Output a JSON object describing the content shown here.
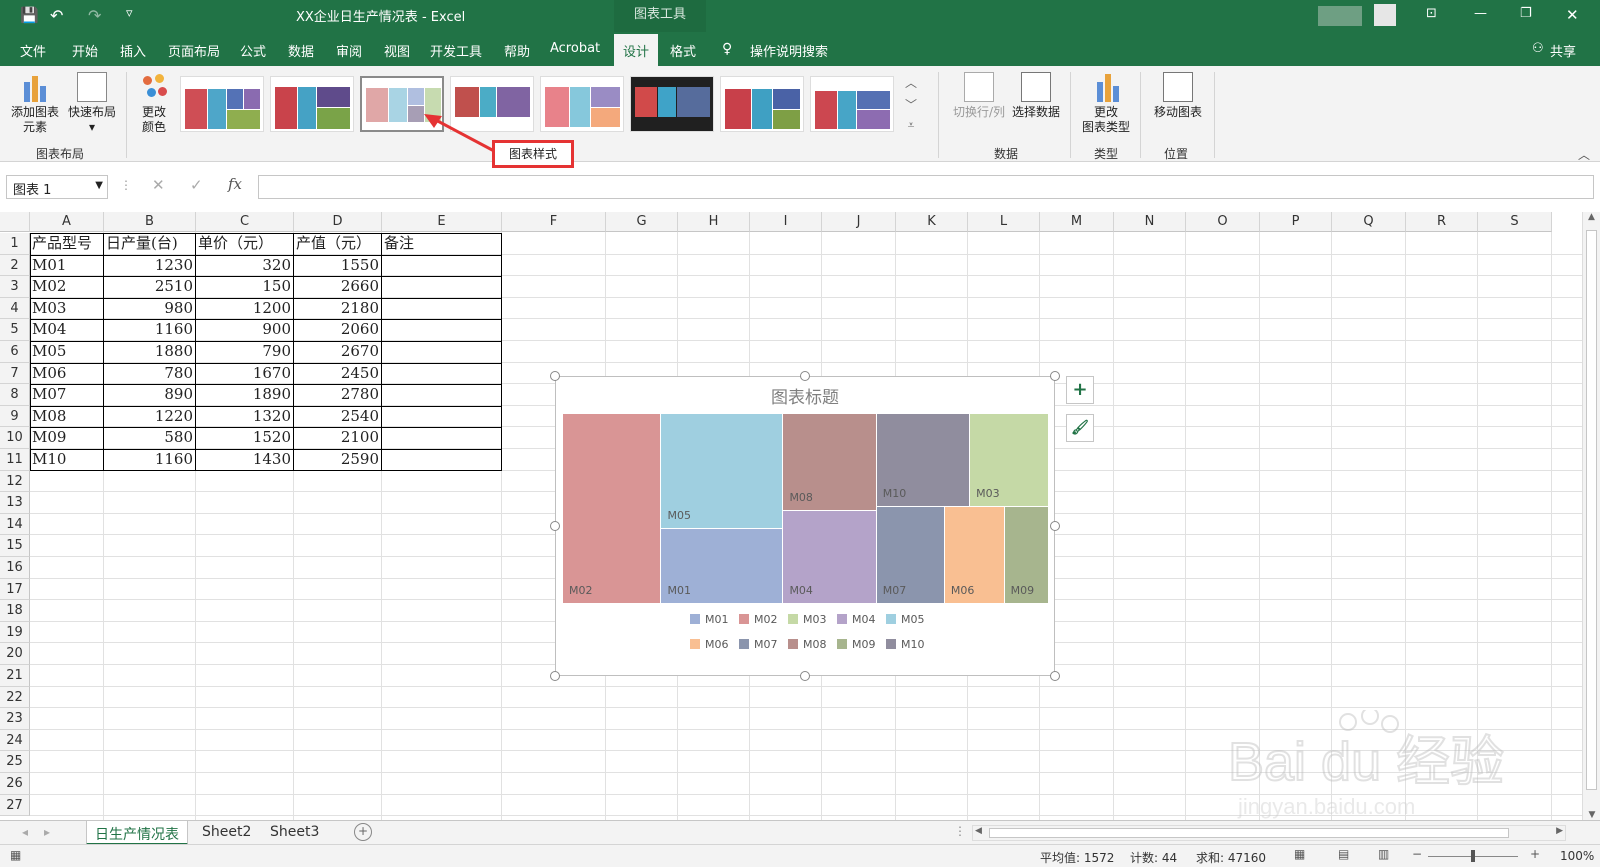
{
  "titlebar": {
    "title": "XX企业日生产情况表  -  Excel",
    "context_tab": "图表工具"
  },
  "ribbon_tabs": [
    "文件",
    "开始",
    "插入",
    "页面布局",
    "公式",
    "数据",
    "审阅",
    "视图",
    "开发工具",
    "帮助",
    "Acrobat",
    "设计",
    "格式"
  ],
  "active_tab": "设计",
  "search_label": "操作说明搜索",
  "share_label": "共享",
  "ribbon": {
    "add_element": [
      "添加图表",
      "元素"
    ],
    "quick_layout": "快速布局",
    "change_color": [
      "更改",
      "颜色"
    ],
    "group_layout": "图表布局",
    "switch_rowcol": "切换行/列",
    "select_data": "选择数据",
    "group_data": "数据",
    "change_type": [
      "更改",
      "图表类型"
    ],
    "group_type": "类型",
    "move_chart": "移动图表",
    "group_location": "位置"
  },
  "callout_label": "图表样式",
  "formula_bar": {
    "name_box": "图表 1",
    "fx": "fx"
  },
  "columns": [
    "A",
    "B",
    "C",
    "D",
    "E",
    "F",
    "G",
    "H",
    "I",
    "J",
    "K",
    "L",
    "M",
    "N",
    "O",
    "P",
    "Q",
    "R",
    "S"
  ],
  "rows": [
    "1",
    "2",
    "3",
    "4",
    "5",
    "6",
    "7",
    "8",
    "9",
    "10",
    "11",
    "12",
    "13",
    "14",
    "15",
    "16",
    "17",
    "18",
    "19",
    "20",
    "21",
    "22",
    "23",
    "24",
    "25",
    "26",
    "27"
  ],
  "table": {
    "headers": [
      "产品型号",
      "日产量(台)",
      "单价（元）",
      "产值（元）",
      "备注"
    ],
    "data": [
      [
        "M01",
        "1230",
        "320",
        "1550",
        ""
      ],
      [
        "M02",
        "2510",
        "150",
        "2660",
        ""
      ],
      [
        "M03",
        "980",
        "1200",
        "2180",
        ""
      ],
      [
        "M04",
        "1160",
        "900",
        "2060",
        ""
      ],
      [
        "M05",
        "1880",
        "790",
        "2670",
        ""
      ],
      [
        "M06",
        "780",
        "1670",
        "2450",
        ""
      ],
      [
        "M07",
        "890",
        "1890",
        "2780",
        ""
      ],
      [
        "M08",
        "1220",
        "1320",
        "2540",
        ""
      ],
      [
        "M09",
        "580",
        "1520",
        "2100",
        ""
      ],
      [
        "M10",
        "1160",
        "1430",
        "2590",
        ""
      ]
    ]
  },
  "chart_data": {
    "type": "treemap",
    "title": "图表标题",
    "categories": [
      "M01",
      "M02",
      "M03",
      "M04",
      "M05",
      "M06",
      "M07",
      "M08",
      "M09",
      "M10"
    ],
    "values": [
      1230,
      2510,
      980,
      1160,
      1880,
      780,
      890,
      1220,
      580,
      1160
    ],
    "colors": {
      "M01": "#9eb0d6",
      "M02": "#d99595",
      "M03": "#c5d9a6",
      "M04": "#b4a3c9",
      "M05": "#9fcfe0",
      "M06": "#f9bf92",
      "M07": "#8b95ad",
      "M08": "#b88f8c",
      "M09": "#a7b58e",
      "M10": "#908d9e"
    },
    "legend_position": "bottom"
  },
  "sheet_tabs": [
    "日生产情况表",
    "Sheet2",
    "Sheet3"
  ],
  "active_sheet": "日生产情况表",
  "status": {
    "average": "平均值: 1572",
    "count": "计数: 44",
    "sum": "求和: 47160",
    "zoom": "100%"
  }
}
